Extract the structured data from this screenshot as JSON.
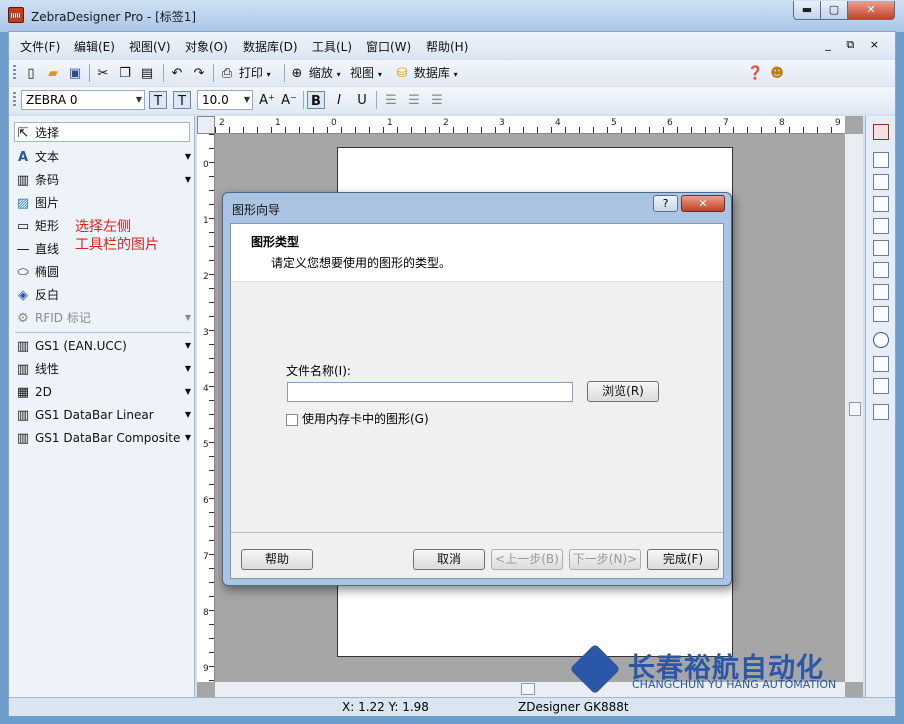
{
  "window": {
    "title": "ZebraDesigner Pro - [标签1]",
    "min": "▬",
    "max": "▢",
    "close": "✕"
  },
  "menu": [
    "文件(F)",
    "编辑(E)",
    "视图(V)",
    "对象(O)",
    "数据库(D)",
    "工具(L)",
    "窗口(W)",
    "帮助(H)"
  ],
  "mdi_buttons": "_ ⧉ ×",
  "toolbar1": {
    "print": "打印",
    "zoom": "缩放",
    "view": "视图",
    "database": "数据库"
  },
  "toolbar2": {
    "printer": "ZEBRA 0",
    "font_size": "10.0",
    "bold": "B",
    "italic": "I",
    "underline": "U"
  },
  "tools": [
    {
      "label": "选择",
      "icon": "cursor-icon",
      "glyph": "⇱"
    },
    {
      "label": "文本",
      "icon": "text-icon",
      "glyph": "A"
    },
    {
      "label": "条码",
      "icon": "barcode-icon",
      "glyph": "▥"
    },
    {
      "label": "图片",
      "icon": "picture-icon",
      "glyph": "▨"
    },
    {
      "label": "矩形",
      "icon": "rectangle-icon",
      "glyph": "▭"
    },
    {
      "label": "直线",
      "icon": "line-icon",
      "glyph": "—"
    },
    {
      "label": "椭圆",
      "icon": "ellipse-icon",
      "glyph": "⬭"
    },
    {
      "label": "反白",
      "icon": "inverse-icon",
      "glyph": "◈"
    },
    {
      "label": "RFID 标记",
      "icon": "rfid-icon",
      "glyph": "⚙"
    }
  ],
  "barcode_tools": [
    "GS1 (EAN.UCC)",
    "线性",
    "2D",
    "GS1 DataBar Linear",
    "GS1 DataBar Composite"
  ],
  "annotation": "选择左侧\n工具栏的图片",
  "ruler_top": [
    "2",
    "1",
    "0",
    "1",
    "2",
    "3",
    "4",
    "5",
    "6",
    "7",
    "8",
    "9"
  ],
  "ruler_left": [
    "0",
    "1",
    "2",
    "3",
    "4",
    "5",
    "6",
    "7",
    "8",
    "9"
  ],
  "dialog": {
    "title": "图形向导",
    "help_button": "?",
    "close_button": "✕",
    "header_title": "图形类型",
    "header_desc": "请定义您想要使用的图形的类型。",
    "file_label": "文件名称(I):",
    "file_value": "",
    "browse": "浏览(R)",
    "checkbox_label": "使用内存卡中的图形(G)",
    "buttons": {
      "help": "帮助",
      "cancel": "取消",
      "back": "<上一步(B)",
      "next": "下一步(N)>",
      "finish": "完成(F)"
    }
  },
  "status": {
    "coords": "X:  1.22 Y:  1.98",
    "printer": "ZDesigner GK888t"
  },
  "watermark": {
    "cn": "长春裕航自动化",
    "en": "CHANGCHUN YU HANG AUTOMATION"
  }
}
